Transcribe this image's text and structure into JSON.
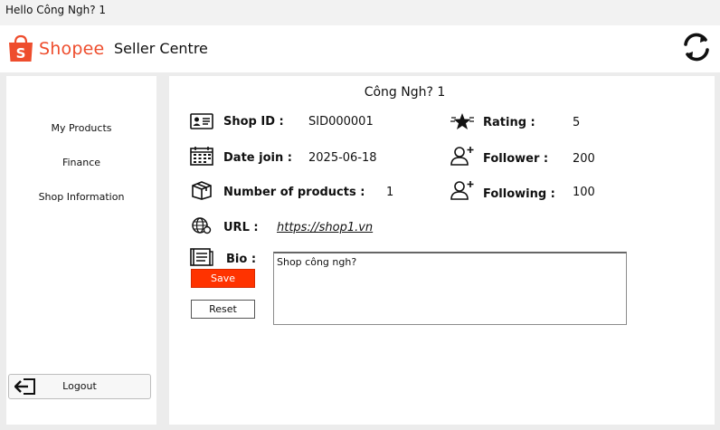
{
  "window": {
    "title": "Hello Công Ngh? 1"
  },
  "header": {
    "brand": "Shopee",
    "title": "Seller Centre"
  },
  "sidebar": {
    "items": [
      {
        "label": "My Products"
      },
      {
        "label": "Finance"
      },
      {
        "label": "Shop Information"
      }
    ],
    "logout_label": "Logout"
  },
  "shop": {
    "name": "Công Ngh? 1",
    "shop_id_label": "Shop ID :",
    "shop_id": "SID000001",
    "date_join_label": "Date join :",
    "date_join": "2025-06-18",
    "products_label": "Number of products :",
    "products": "1",
    "url_label": "URL :",
    "url": "https://shop1.vn",
    "bio_label": "Bio :",
    "bio": "Shop công ngh?",
    "rating_label": "Rating :",
    "rating": "5",
    "follower_label": "Follower :",
    "follower": "200",
    "following_label": "Following :",
    "following": "100"
  },
  "actions": {
    "save_label": "Save",
    "reset_label": "Reset"
  },
  "colors": {
    "brand": "#ee4d2d",
    "save": "#ff3300",
    "background": "#ececec"
  },
  "icons": [
    "shopee-bag-icon",
    "refresh-icon",
    "logout-icon",
    "id-card-icon",
    "calendar-icon",
    "box-icon",
    "web-icon",
    "notebook-icon",
    "star-rating-icon",
    "follower-icon",
    "following-icon"
  ]
}
